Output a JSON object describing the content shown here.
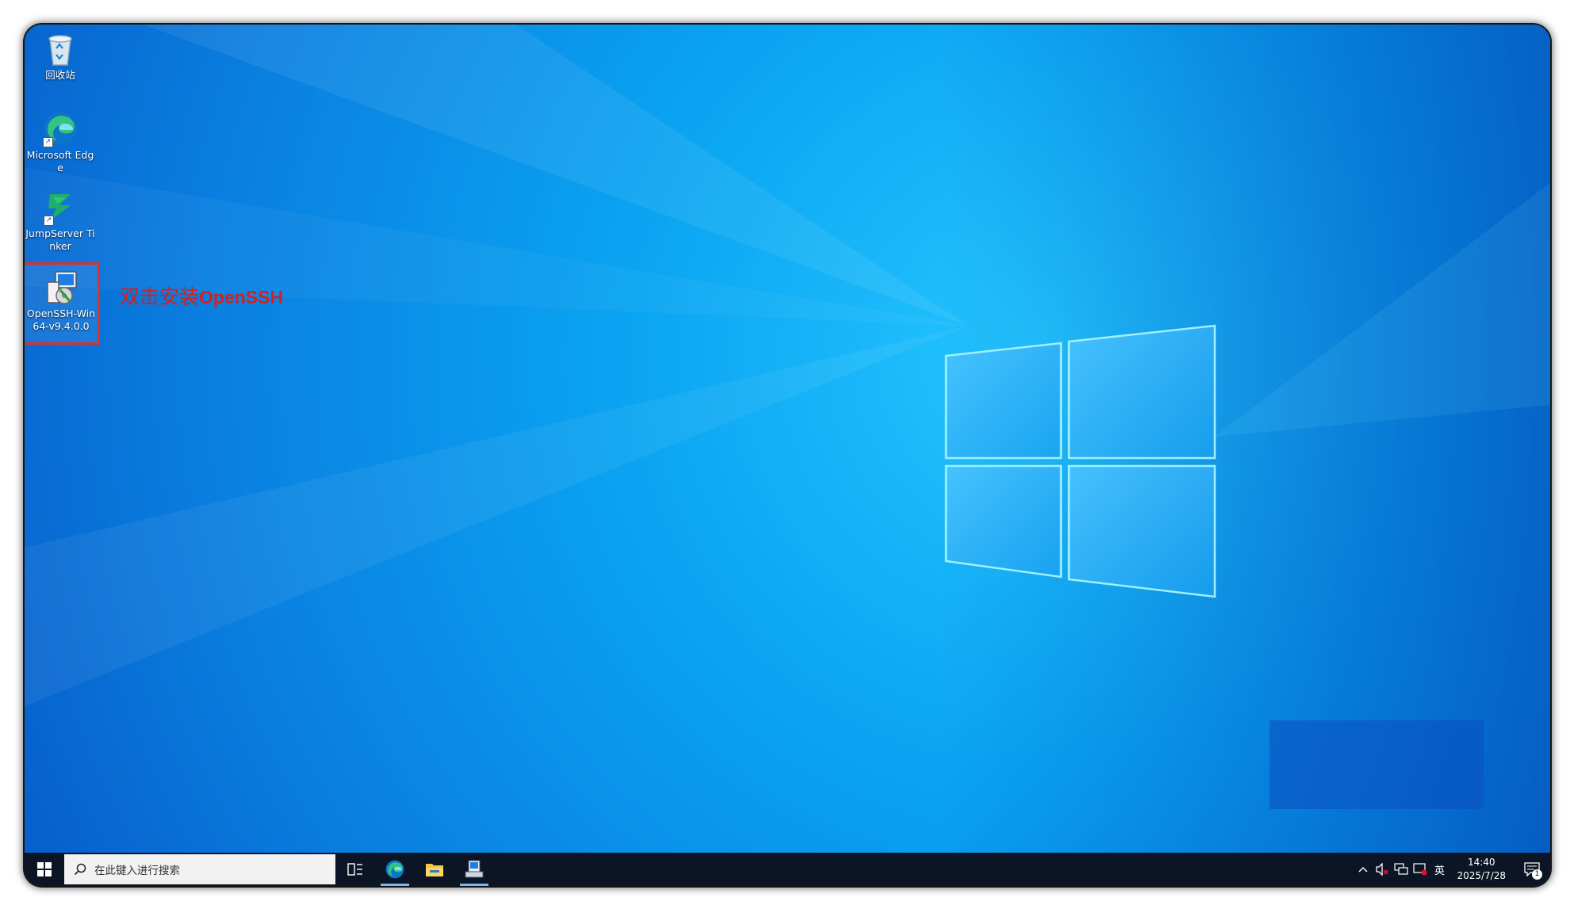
{
  "desktop": {
    "icons": [
      {
        "label": "回收站"
      },
      {
        "label": "Microsoft Edge"
      },
      {
        "label": "JumpServer Tinker"
      },
      {
        "label": "OpenSSH-Win64-v9.4.0.0"
      }
    ],
    "annotation": {
      "cjk": "双击安装",
      "latin": "OpenSSH",
      "color": "#d32020"
    }
  },
  "taskbar": {
    "search": {
      "placeholder": "在此键入进行搜索"
    },
    "pinned": [
      "task-view-icon",
      "edge-icon",
      "file-explorer-icon",
      "installer-icon"
    ],
    "tray": {
      "ime": "英",
      "time": "14:40",
      "date": "2025/7/28",
      "notification_count": "1"
    }
  },
  "colors": {
    "accent": "#0078d7",
    "taskbar": "#0b1526",
    "highlight": "#d9312f"
  }
}
